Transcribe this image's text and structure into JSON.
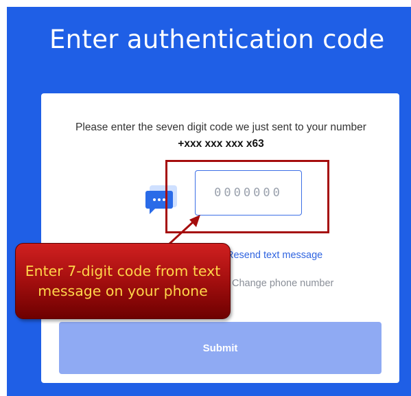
{
  "page": {
    "title": "Enter authentication code"
  },
  "form": {
    "instruction_prefix": "Please enter the seven digit code we just sent to your number ",
    "phone_number": "+xxx xxx xxx x63",
    "code_input": {
      "value": "",
      "placeholder": "0000000"
    },
    "message_icon": "chat-bubble-icon",
    "resend_link_label": "Resend text message",
    "change_number_label": "Change phone number",
    "submit_label": "Submit"
  },
  "annotation": {
    "callout_text": "Enter 7-digit code from text message on your phone",
    "highlight_color": "#a50d0d",
    "callout_text_color": "#ffd64a"
  },
  "colors": {
    "brand_blue": "#1f5fe6",
    "link_blue": "#2f64e0",
    "submit_disabled": "#8faaf3"
  }
}
